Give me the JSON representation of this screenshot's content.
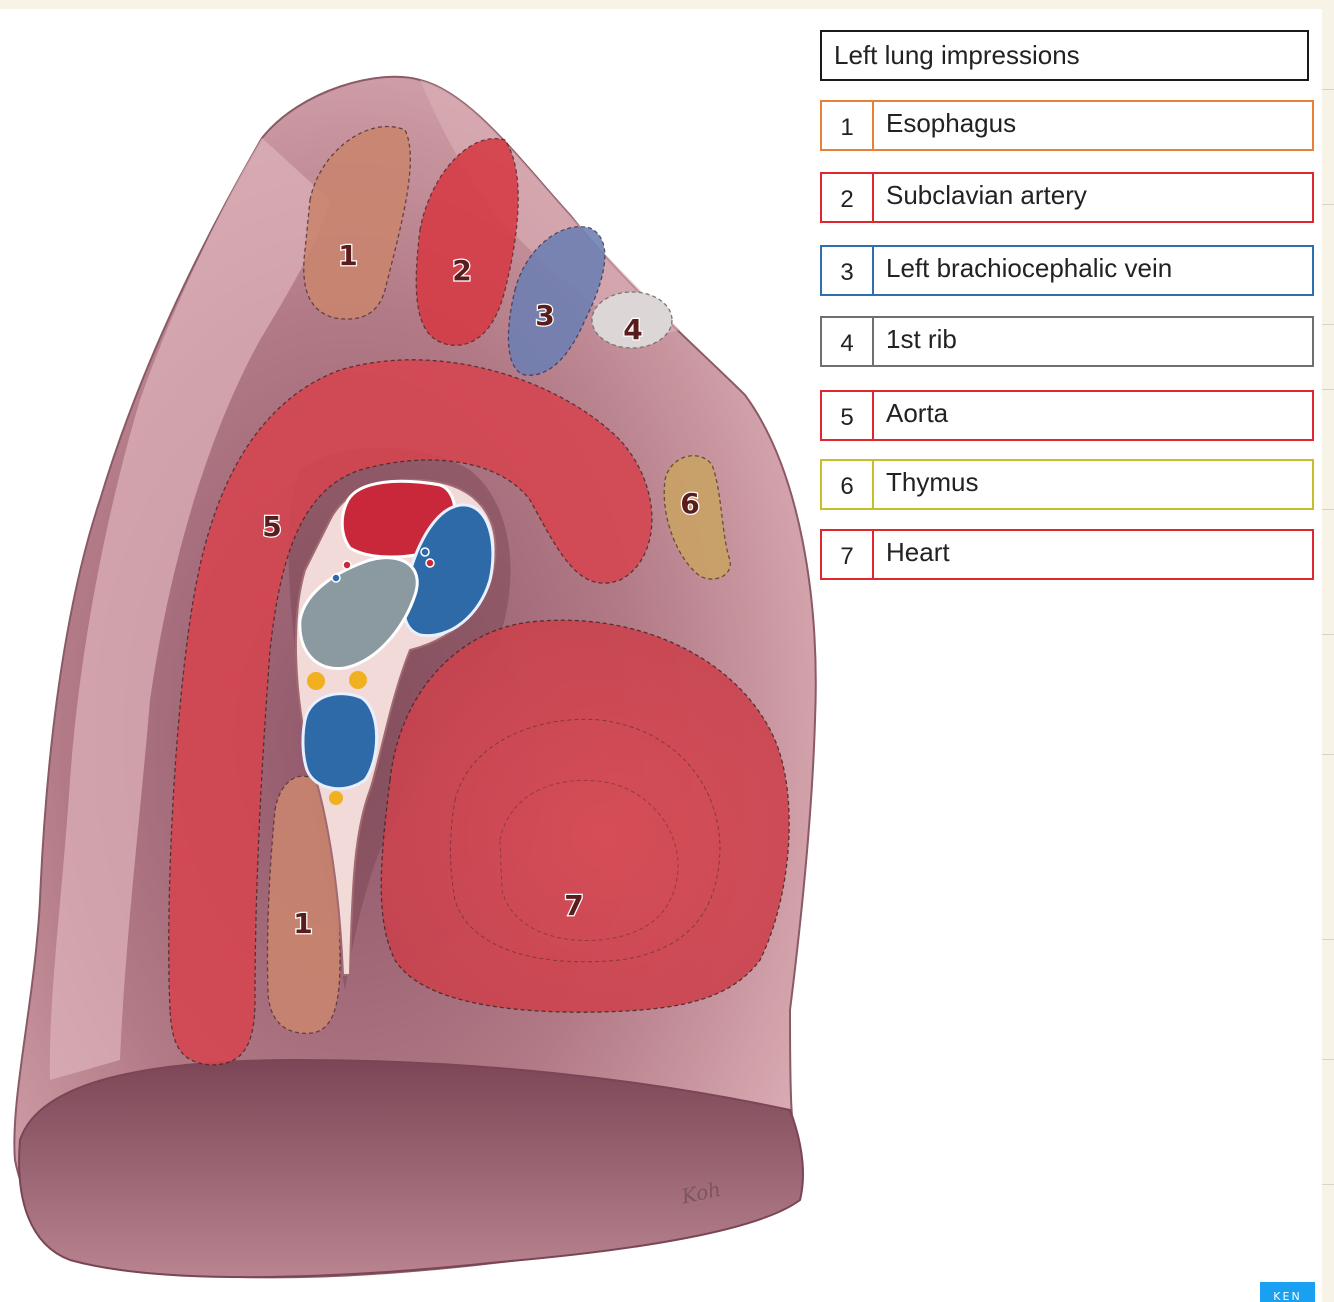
{
  "legend": {
    "title": "Left lung impressions",
    "items": [
      {
        "num": "1",
        "label": "Esophagus",
        "color": "#e8803a"
      },
      {
        "num": "2",
        "label": "Subclavian artery",
        "color": "#e0262f"
      },
      {
        "num": "3",
        "label": "Left brachiocephalic vein",
        "color": "#2f6fb0"
      },
      {
        "num": "4",
        "label": "1st rib",
        "color": "#6f6f6f"
      },
      {
        "num": "5",
        "label": "Aorta",
        "color": "#e0262f"
      },
      {
        "num": "6",
        "label": "Thymus",
        "color": "#c8be2a"
      },
      {
        "num": "7",
        "label": "Heart",
        "color": "#e0262f"
      }
    ]
  },
  "illustration": {
    "labels": {
      "esophagus_upper": "1",
      "subclavian": "2",
      "brachiocephalic": "3",
      "first_rib": "4",
      "aorta": "5",
      "thymus": "6",
      "esophagus_lower": "1",
      "heart": "7"
    },
    "signature": "Koh",
    "colors": {
      "lung_light": "#e0b4bc",
      "lung_dark": "#8a5262",
      "artery": "#dc4650",
      "vein": "#3a78b8",
      "esophagus": "#c98b72",
      "thymus": "#c9a56a",
      "rib": "#d6d0d0"
    }
  },
  "badge": "KEN"
}
